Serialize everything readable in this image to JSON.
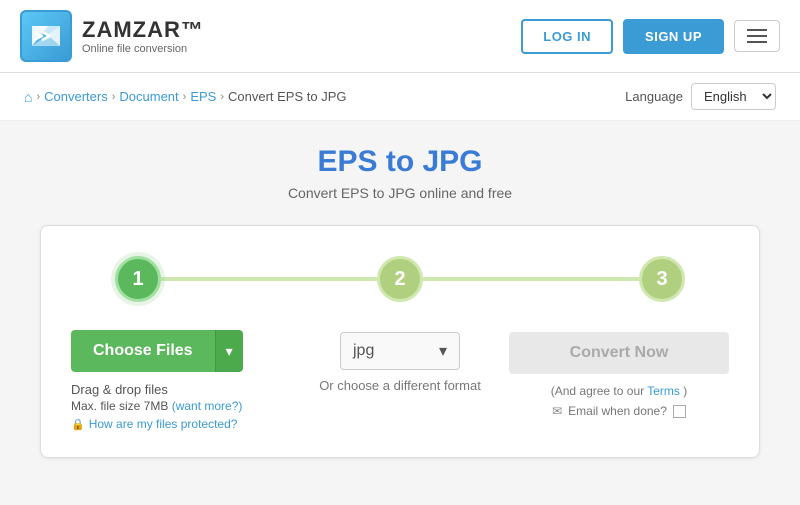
{
  "header": {
    "logo_name": "ZAMZAR™",
    "logo_tagline": "Online file conversion",
    "login_label": "LOG IN",
    "signup_label": "SIGN UP"
  },
  "breadcrumb": {
    "home_icon": "⌂",
    "items": [
      "Converters",
      "Document",
      "EPS"
    ],
    "current": "Convert EPS to JPG"
  },
  "language": {
    "label": "Language",
    "selected": "English"
  },
  "page": {
    "title": "EPS to JPG",
    "subtitle": "Convert EPS to JPG online and free"
  },
  "steps": [
    {
      "number": "1",
      "active": true
    },
    {
      "number": "2",
      "active": false
    },
    {
      "number": "3",
      "active": false
    }
  ],
  "step1": {
    "button_label": "Choose Files",
    "arrow": "▾",
    "drag_text": "Drag & drop files",
    "max_file": "Max. file size 7MB",
    "want_more": "(want more?)",
    "protected_text": "How are my files protected?"
  },
  "step2": {
    "format": "jpg",
    "dropdown_arrow": "▾",
    "help_text": "Or choose a different format"
  },
  "step3": {
    "button_label": "Convert Now",
    "terms_text": "(And agree to our",
    "terms_link": "Terms",
    "terms_close": ")",
    "email_label": "Email when done?",
    "email_icon": "✉"
  }
}
